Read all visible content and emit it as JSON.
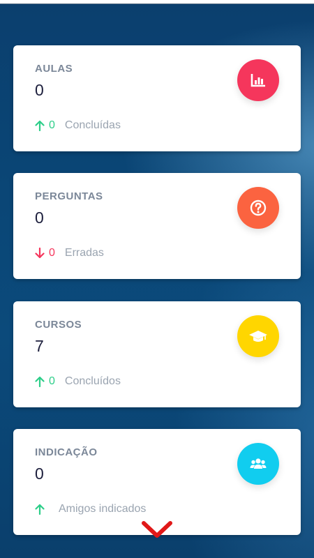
{
  "colors": {
    "aulas_badge": "#f5365c",
    "perguntas_badge": "#fb6340",
    "cursos_badge": "#ffd600",
    "indicacao_badge": "#11cdef",
    "up": "#2dce89",
    "down": "#f5365c",
    "chevron": "#e01818"
  },
  "cards": [
    {
      "title": "AULAS",
      "value": "0",
      "trend": "up",
      "trend_value": "0",
      "label": "Concluídas",
      "icon": "chart-bar-icon"
    },
    {
      "title": "PERGUNTAS",
      "value": "0",
      "trend": "down",
      "trend_value": "0",
      "label": "Erradas",
      "icon": "question-circle-icon"
    },
    {
      "title": "CURSOS",
      "value": "7",
      "trend": "up",
      "trend_value": "0",
      "label": "Concluídos",
      "icon": "graduation-cap-icon"
    },
    {
      "title": "INDICAÇÃO",
      "value": "0",
      "trend": "up",
      "trend_value": "",
      "label": "Amigos indicados",
      "icon": "users-icon"
    }
  ],
  "scroll_indicator": {
    "icon": "chevron-down-icon"
  }
}
